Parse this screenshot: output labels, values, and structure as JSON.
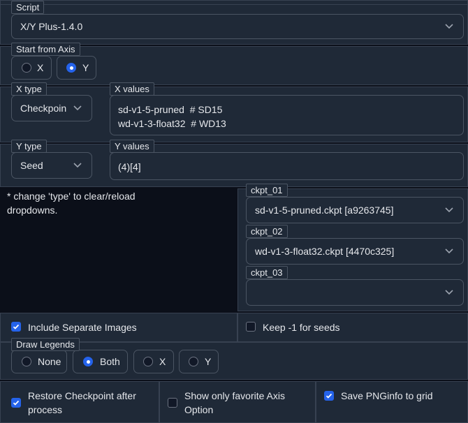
{
  "script": {
    "label": "Script",
    "value": "X/Y Plus-1.4.0"
  },
  "start_axis": {
    "label": "Start from Axis",
    "options": [
      {
        "label": "X",
        "checked": false
      },
      {
        "label": "Y",
        "checked": true
      }
    ]
  },
  "x_type": {
    "label": "X type",
    "value": "Checkpoin"
  },
  "x_values": {
    "label": "X values",
    "lines": [
      "sd-v1-5-pruned  # SD15",
      "wd-v1-3-float32  # WD13"
    ]
  },
  "y_type": {
    "label": "Y type",
    "value": "Seed"
  },
  "y_values": {
    "label": "Y values",
    "value": "(4)[4]"
  },
  "note": "* change 'type' to clear/reload dropdowns.",
  "ckpts": [
    {
      "label": "ckpt_01",
      "value": "sd-v1-5-pruned.ckpt [a9263745]"
    },
    {
      "label": "ckpt_02",
      "value": "wd-v1-3-float32.ckpt [4470c325]"
    },
    {
      "label": "ckpt_03",
      "value": ""
    }
  ],
  "include_separate": {
    "label": "Include Separate Images",
    "checked": true
  },
  "keep_seeds": {
    "label": "Keep -1 for seeds",
    "checked": false
  },
  "draw_legends": {
    "label": "Draw Legends",
    "options": [
      {
        "label": "None",
        "checked": false
      },
      {
        "label": "Both",
        "checked": true
      },
      {
        "label": "X",
        "checked": false
      },
      {
        "label": "Y",
        "checked": false
      }
    ]
  },
  "bottom": {
    "restore": {
      "label": "Restore Checkpoint after process",
      "checked": true
    },
    "favorite": {
      "label": "Show only favorite Axis Option",
      "checked": false
    },
    "pnginfo": {
      "label": "Save PNGinfo to grid",
      "checked": true
    }
  },
  "colors": {
    "accent": "#2563eb",
    "panel": "#1f2937",
    "background": "#0b0f19",
    "border": "#4b5563"
  }
}
